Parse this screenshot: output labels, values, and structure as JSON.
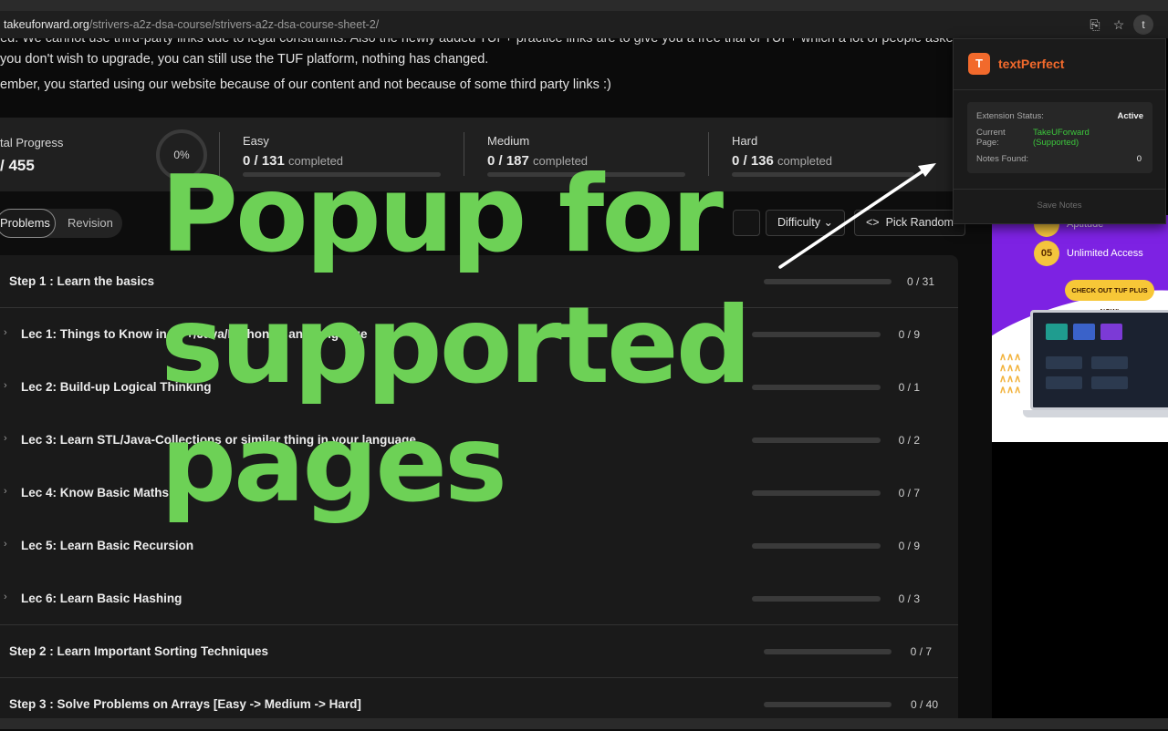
{
  "browser": {
    "url_host": "takeuforward.org",
    "url_path": "/strivers-a2z-dsa-course/strivers-a2z-dsa-course-sheet-2/",
    "avatar_letter": "t"
  },
  "notice": {
    "line1": "ned. We cannot use third-party links due to legal constraints. Also the newly added TUF+ practice links are to give you a free trial of TUF+ which a lot of people asked",
    "line2": "you don't wish to upgrade, you can still use the TUF platform, nothing has changed.",
    "line3": "ember, you started using our website because of our content and not because of some third party links :)"
  },
  "progress": {
    "total_label": "tal Progress",
    "total_value": "/ 455",
    "percent": "0%",
    "easy": {
      "name": "Easy",
      "value": "0 / 131",
      "suffix": "completed"
    },
    "medium": {
      "name": "Medium",
      "value": "0 / 187",
      "suffix": "completed"
    },
    "hard": {
      "name": "Hard",
      "value": "0 / 136",
      "suffix": "completed"
    }
  },
  "toolbar": {
    "tab_problems": "Problems",
    "tab_revision": "Revision",
    "difficulty": "Difficulty",
    "pick_random": "Pick Random"
  },
  "list": {
    "step1": {
      "title": "Step 1 : Learn the basics",
      "count": "0 / 31"
    },
    "lectures": [
      {
        "title": "Lec 1: Things to Know in C++/Java/Python or any language",
        "count": "0 / 9"
      },
      {
        "title": "Lec 2: Build-up Logical Thinking",
        "count": "0 / 1"
      },
      {
        "title": "Lec 3: Learn STL/Java-Collections or similar thing in your language",
        "count": "0 / 2"
      },
      {
        "title": "Lec 4: Know Basic Maths",
        "count": "0 / 7"
      },
      {
        "title": "Lec 5: Learn Basic Recursion",
        "count": "0 / 9"
      },
      {
        "title": "Lec 6: Learn Basic Hashing",
        "count": "0 / 3"
      }
    ],
    "step2": {
      "title": "Step 2 : Learn Important Sorting Techniques",
      "count": "0 / 7"
    },
    "step3": {
      "title": "Step 3 : Solve Problems on Arrays [Easy -> Medium -> Hard]",
      "count": "0 / 40"
    }
  },
  "ad": {
    "item_top": "Aptitude",
    "badge": "05",
    "item_unlimited": "Unlimited Access",
    "cta": "CHECK OUT TUF PLUS NOW!"
  },
  "popup": {
    "logo_letter": "T",
    "title": "textPerfect",
    "status_label": "Extension Status:",
    "status_value": "Active",
    "page_label_1": "Current",
    "page_label_2": "Page:",
    "page_value_1": "TakeUForward",
    "page_value_2": "(Supported)",
    "notes_label": "Notes Found:",
    "notes_value": "0",
    "save": "Save Notes",
    "accent": "#f26a2c",
    "supported_color": "#3cc63c"
  },
  "overlay": {
    "line1": "Popup for",
    "line2": "supported",
    "line3": "pages",
    "color": "#6dd156"
  }
}
